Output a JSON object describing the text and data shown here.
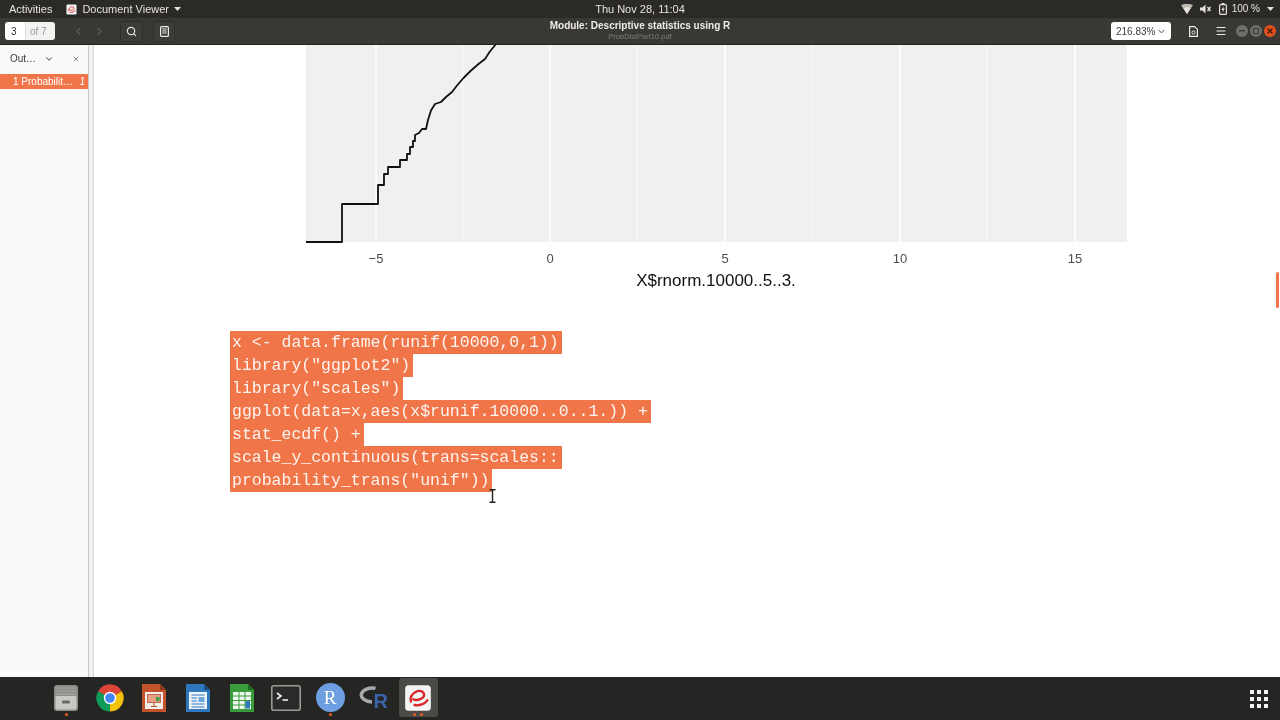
{
  "top_bar": {
    "activities": "Activities",
    "app_menu": "Document Viewer",
    "clock": "Thu Nov 28, 11:04",
    "battery_reading": "100 %"
  },
  "header_bar": {
    "page_field": {
      "value": "3",
      "count": "of 7"
    },
    "nav_buttons": [
      {
        "kind": "back",
        "disabled": true
      },
      {
        "kind": "forward",
        "disabled": true
      }
    ],
    "title": "Module: Descriptive statistics using R",
    "subtitle": "ProbDistPart10.pdf",
    "zoom": "216.83%"
  },
  "sidebar": {
    "view": "Out…",
    "items": [
      {
        "label": "1 Probabilit…",
        "page": "1",
        "selected": true
      }
    ]
  },
  "plot": {
    "x_tick_labels": [
      "−5",
      "0",
      "5",
      "10",
      "15"
    ],
    "x_axis_title": "X$rnorm.10000..5..3."
  },
  "code": {
    "selected": true,
    "lines": [
      "x <- data.frame(runif(10000,0,1))",
      "library(\"ggplot2\")",
      "library(\"scales\")",
      "ggplot(data=x,aes(x$runif.10000..0..1.)) +",
      "stat_ecdf() +",
      "scale_y_continuous(trans=scales::",
      "probability_trans(\"unif\"))"
    ]
  },
  "dock": {
    "apps": [
      {
        "kind": "files",
        "running": true,
        "selected": false,
        "several_windows": false
      },
      {
        "kind": "browser",
        "running": false,
        "selected": false,
        "several_windows": false
      },
      {
        "kind": "presentation",
        "running": false,
        "selected": false,
        "several_windows": false
      },
      {
        "kind": "text-document",
        "running": false,
        "selected": false,
        "several_windows": false
      },
      {
        "kind": "spreadsheet",
        "running": false,
        "selected": false,
        "several_windows": false
      },
      {
        "kind": "terminal",
        "running": false,
        "selected": false,
        "several_windows": false
      },
      {
        "kind": "r-console",
        "glyph": "R",
        "running": true,
        "selected": false,
        "several_windows": false
      },
      {
        "kind": "r-studio",
        "glyph": "R",
        "running": false,
        "selected": false,
        "several_windows": false
      },
      {
        "kind": "document-viewer",
        "running": true,
        "selected": true,
        "several_windows": true
      }
    ]
  }
}
